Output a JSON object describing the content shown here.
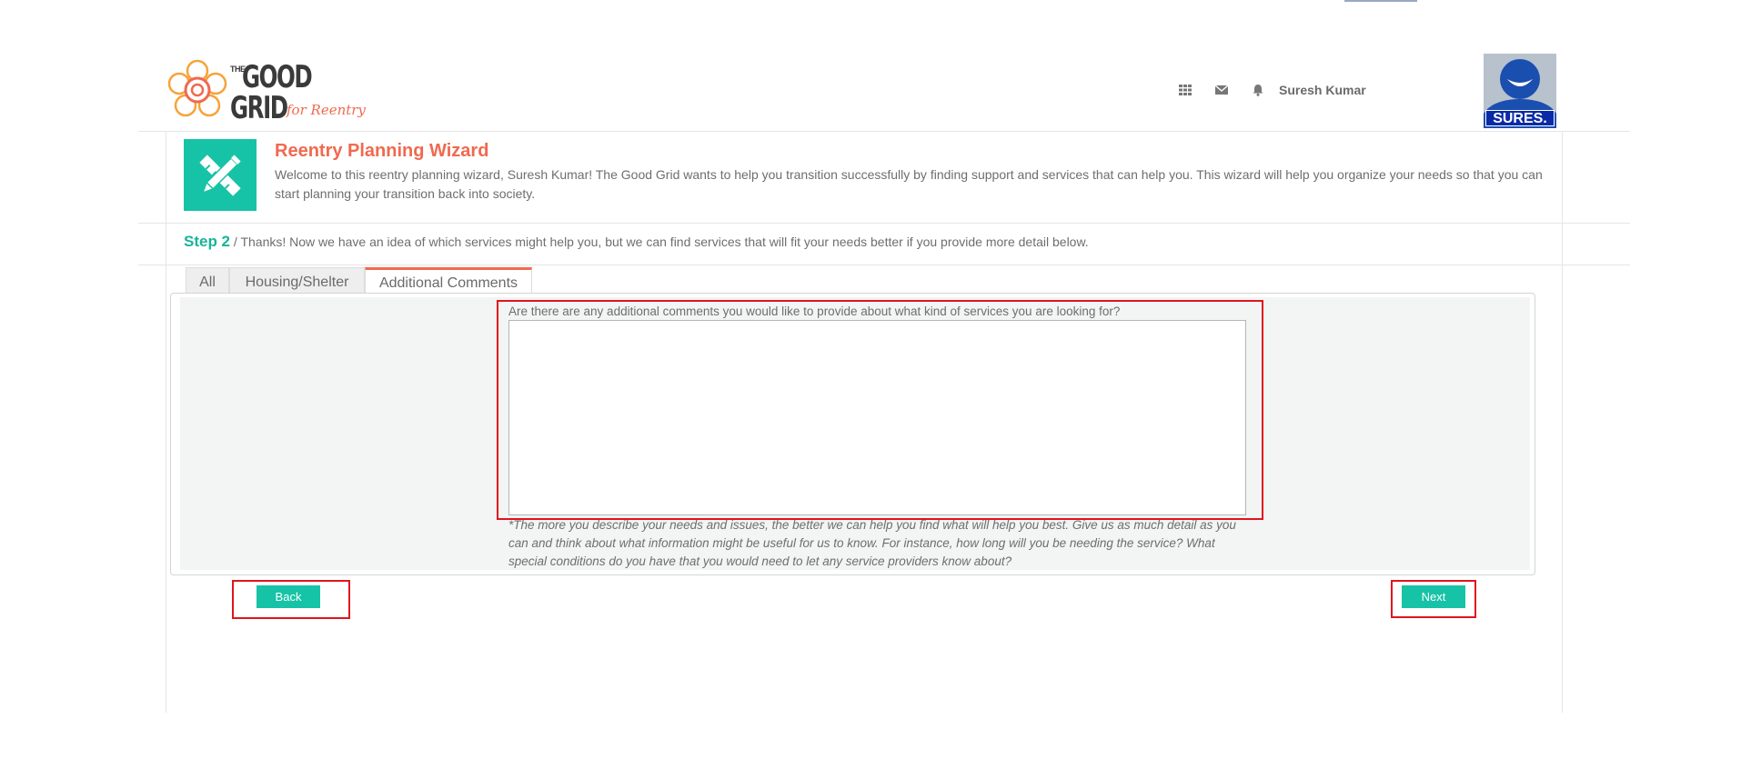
{
  "header": {
    "logo": {
      "the": "THE",
      "good": "GOOD",
      "grid": "GRID",
      "tagline": "for Reentry"
    },
    "icons": [
      "grid-icon",
      "envelope-icon",
      "bell-icon"
    ],
    "user_name": "Suresh Kumar",
    "avatar_label": "SURES."
  },
  "wizard": {
    "title": "Reentry Planning Wizard",
    "description": "Welcome to this reentry planning wizard, Suresh Kumar! The Good Grid wants to help you transition successfully by finding support and services that can help you. This wizard will help you organize your needs so that you can start planning your transition back into society.",
    "icon": "pencil-ruler-icon"
  },
  "step": {
    "label": "Step 2",
    "text": " / Thanks! Now we have an idea of which services might help you, but we can find services that will fit your needs better if you provide more detail below."
  },
  "tabs": [
    {
      "label": "All",
      "active": false
    },
    {
      "label": "Housing/Shelter",
      "active": false
    },
    {
      "label": "Additional Comments",
      "active": true
    }
  ],
  "form": {
    "question": "Are there are any additional comments you would like to provide about what kind of services you are looking for?",
    "comments_value": "",
    "hint": "*The more you describe your needs and issues, the better we can help you find what will help you best. Give us as much detail as you can and think about what information might be useful for us to know. For instance, how long will you be needing the service? What special conditions do you have that you would need to let any service providers know about?"
  },
  "buttons": {
    "back": "Back",
    "next": "Next"
  },
  "colors": {
    "accent_teal": "#17c3a6",
    "accent_orange": "#f0694f",
    "highlight_red": "#e0141e"
  }
}
